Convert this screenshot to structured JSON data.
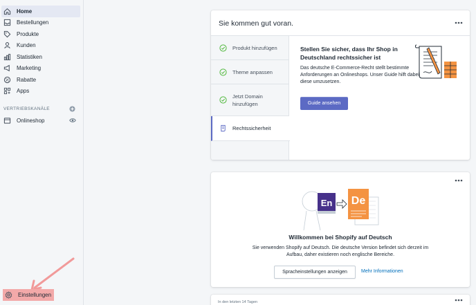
{
  "sidebar": {
    "items": [
      {
        "label": "Home",
        "icon": "home-icon"
      },
      {
        "label": "Bestellungen",
        "icon": "orders-icon"
      },
      {
        "label": "Produkte",
        "icon": "tag-icon"
      },
      {
        "label": "Kunden",
        "icon": "person-icon"
      },
      {
        "label": "Statistiken",
        "icon": "bar-chart-icon"
      },
      {
        "label": "Marketing",
        "icon": "target-icon"
      },
      {
        "label": "Rabatte",
        "icon": "discount-icon"
      },
      {
        "label": "Apps",
        "icon": "apps-icon"
      }
    ],
    "channels_label": "VERTRIEBSKANÄLE",
    "channel": "Onlineshop",
    "settings_label": "Einstellungen"
  },
  "setup_card": {
    "title": "Sie kommen gut voran.",
    "steps": [
      {
        "label": "Produkt hinzufügen",
        "done": true
      },
      {
        "label": "Theme anpassen",
        "done": true
      },
      {
        "label": "Jetzt Domain hinzufügen",
        "done": true
      },
      {
        "label": "Rechtssicherheit",
        "done": false
      }
    ],
    "panel_title": "Stellen Sie sicher, dass Ihr Shop in Deutschland rechtssicher ist",
    "panel_text": "Das deutsche E-Commerce-Recht stellt bestimmte Anforderungen an Onlineshops. Unser Guide hilft dabei, diese umzusetzen.",
    "button": "Guide ansehen"
  },
  "welcome_card": {
    "lang_from": "En",
    "lang_to": "De",
    "title": "Willkommen bei Shopify auf Deutsch",
    "text": "Sie verwenden Shopify auf Deutsch. Die deutsche Version befindet sich derzeit im Aufbau, daher existieren noch englische Bereiche.",
    "button": "Spracheinstellungen anzeigen",
    "link": "Mehr Informationen"
  },
  "stats_card": {
    "text": "In den letzten 14 Tagen"
  },
  "colors": {
    "accent": "#5c6ac4",
    "highlight": "#f3a9a9",
    "success": "#50b83c",
    "link": "#006fbb",
    "illustration_orange": "#f49342",
    "illustration_purple": "#47318a"
  }
}
